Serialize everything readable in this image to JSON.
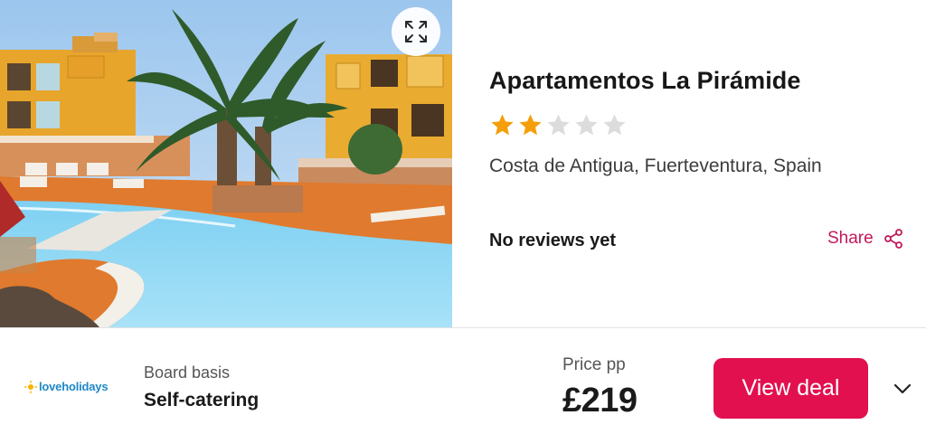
{
  "hotel": {
    "name": "Apartamentos La Pirámide",
    "star_rating": 2,
    "star_max": 5,
    "location": "Costa de Antigua, Fuerteventura, Spain",
    "reviews_text": "No reviews yet"
  },
  "actions": {
    "share_label": "Share",
    "expand_icon": "expand-icon",
    "share_icon": "share-icon"
  },
  "deal": {
    "provider_name": "loveholidays",
    "board_label": "Board basis",
    "board_value": "Self-catering",
    "price_label": "Price pp",
    "price_value": "£219",
    "cta_label": "View deal",
    "expand_icon": "chevron-down-icon"
  },
  "colors": {
    "accent": "#e2104f",
    "share_text": "#c2185b",
    "star_filled": "#f59e0b",
    "star_empty": "#dcdcdc",
    "provider_brand": "#1e88c8"
  }
}
